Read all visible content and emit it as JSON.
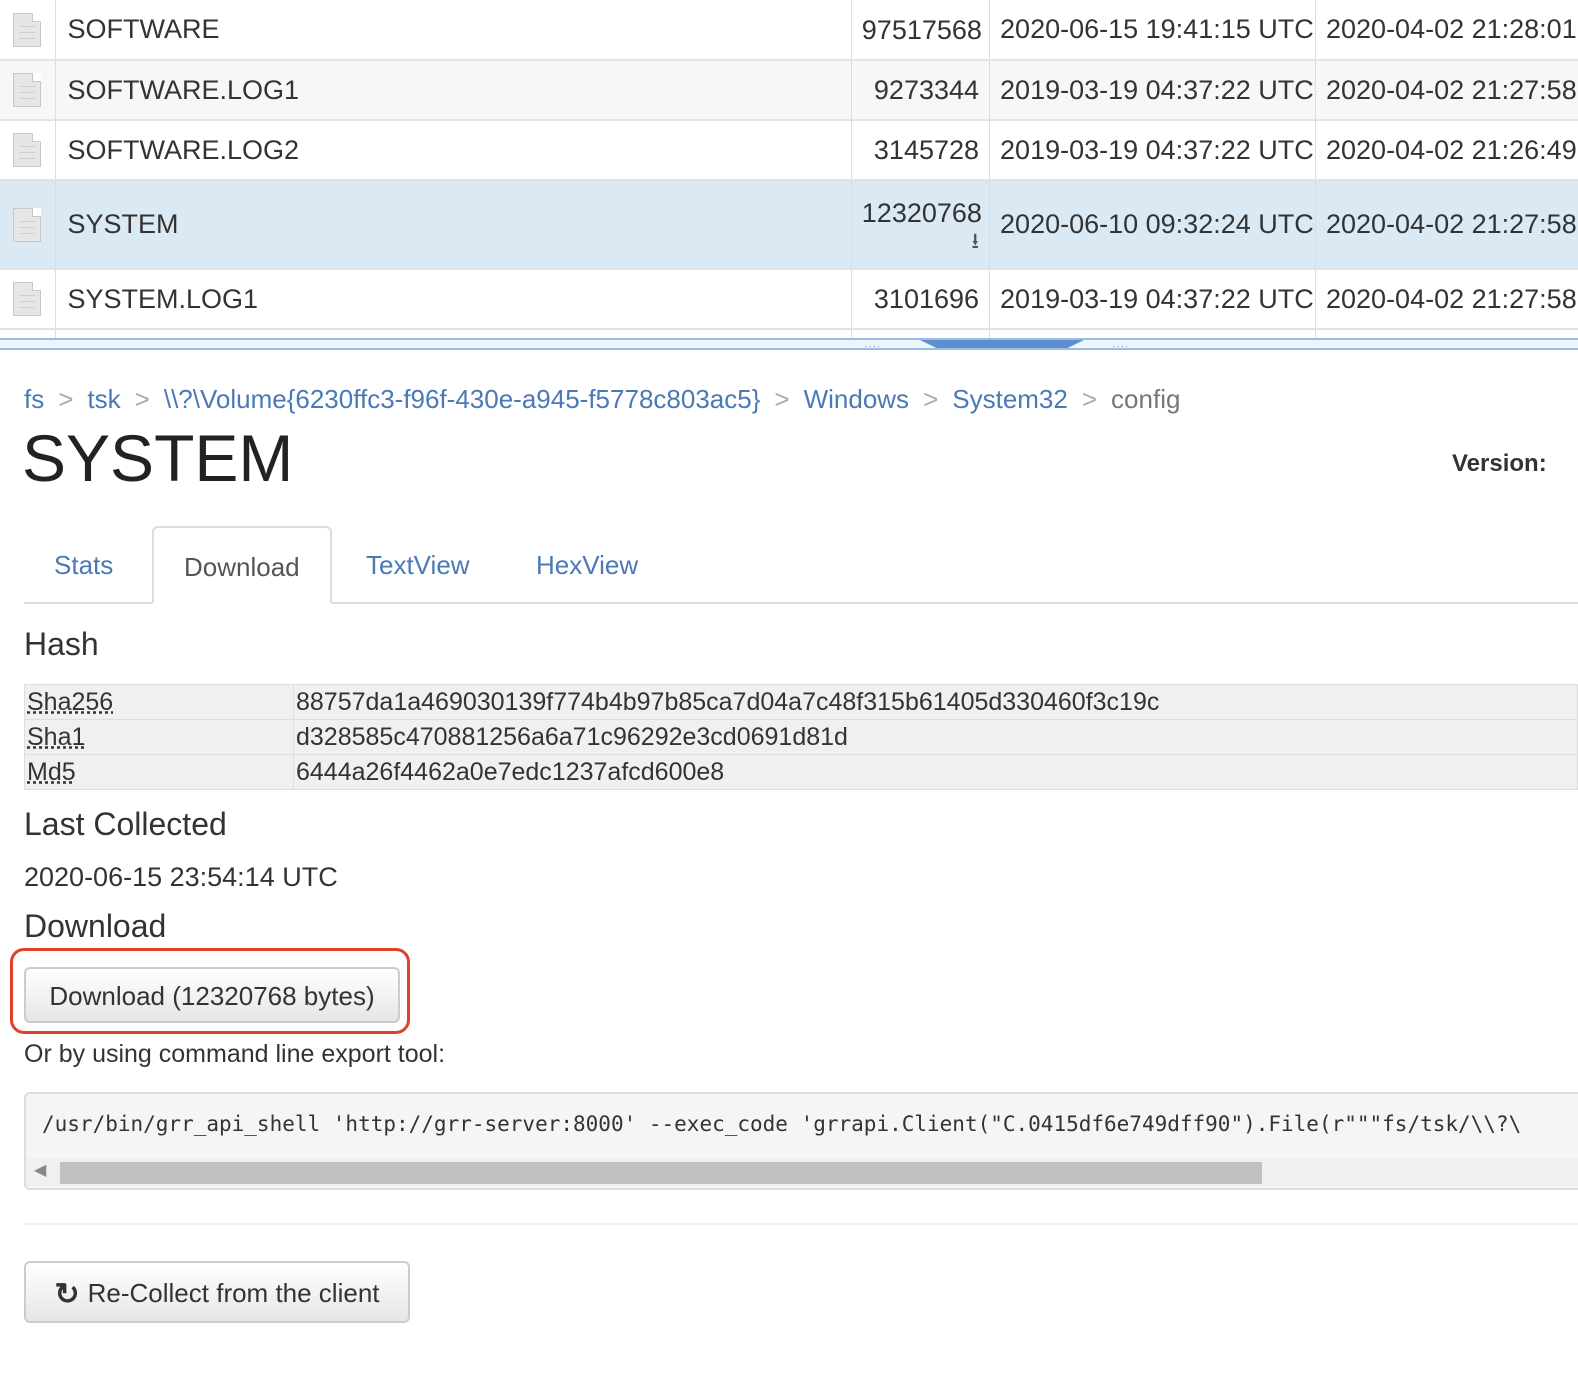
{
  "files": [
    {
      "name": "SOFTWARE",
      "size": "97517568",
      "mtime": "2020-06-15 19:41:15 UTC",
      "ctime": "2020-04-02 21:28:01",
      "selected": false
    },
    {
      "name": "SOFTWARE.LOG1",
      "size": "9273344",
      "mtime": "2019-03-19 04:37:22 UTC",
      "ctime": "2020-04-02 21:27:58",
      "selected": false
    },
    {
      "name": "SOFTWARE.LOG2",
      "size": "3145728",
      "mtime": "2019-03-19 04:37:22 UTC",
      "ctime": "2020-04-02 21:26:49",
      "selected": false
    },
    {
      "name": "SYSTEM",
      "size": "12320768",
      "mtime": "2020-06-10 09:32:24 UTC",
      "ctime": "2020-04-02 21:27:58",
      "selected": true
    },
    {
      "name": "SYSTEM.LOG1",
      "size": "3101696",
      "mtime": "2019-03-19 04:37:22 UTC",
      "ctime": "2020-04-02 21:27:58",
      "selected": false
    }
  ],
  "breadcrumb": {
    "items": [
      "fs",
      "tsk",
      "\\\\?\\Volume{6230ffc3-f96f-430e-a945-f5778c803ac5}",
      "Windows",
      "System32"
    ],
    "current": "config",
    "separator": ">"
  },
  "title": "SYSTEM",
  "version_label": "Version:",
  "tabs": [
    "Stats",
    "Download",
    "TextView",
    "HexView"
  ],
  "active_tab": "Download",
  "hash": {
    "heading": "Hash",
    "rows": [
      {
        "key": "Sha256",
        "value": "88757da1a469030139f774b4b97b85ca7d04a7c48f315b61405d330460f3c19c"
      },
      {
        "key": "Sha1",
        "value": "d328585c470881256a6a71c96292e3cd0691d81d"
      },
      {
        "key": "Md5",
        "value": "6444a26f4462a0e7edc1237afcd600e8"
      }
    ]
  },
  "last_collected": {
    "heading": "Last Collected",
    "value": "2020-06-15 23:54:14 UTC"
  },
  "download": {
    "heading": "Download",
    "button_label": "Download (12320768 bytes)",
    "cli_label": "Or by using command line export tool:",
    "cli_command": "/usr/bin/grr_api_shell 'http://grr-server:8000' --exec_code 'grrapi.Client(\"C.0415df6e749dff90\").File(r\"\"\"fs/tsk/\\\\?\\"
  },
  "recollect_label": "Re-Collect from the client",
  "icons": {
    "file": "file-icon",
    "download": "download-icon",
    "refresh": "refresh-icon",
    "scroll_left": "chevron-left-icon"
  },
  "colors": {
    "link": "#4a79b5",
    "selected_row": "#dbe9f5",
    "highlight": "#e0402c"
  }
}
